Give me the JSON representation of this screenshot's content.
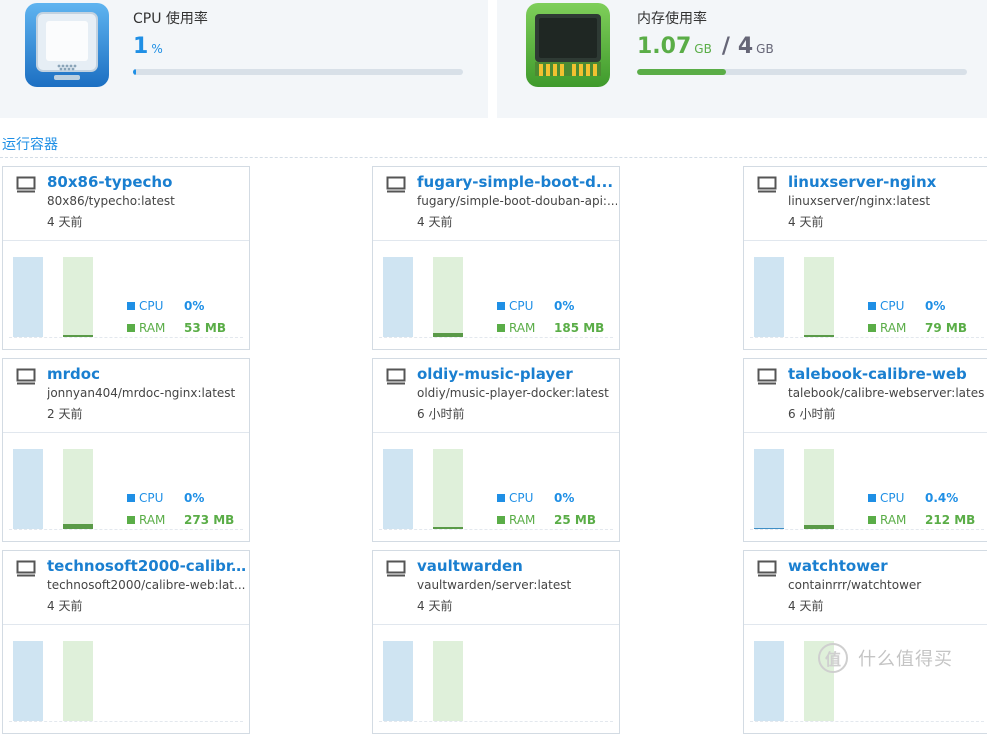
{
  "cpu_widget": {
    "title": "CPU 使用率",
    "value": "1",
    "unit": "%",
    "usage_fraction": 0.01,
    "icon": "cpu-chip-icon"
  },
  "memory_widget": {
    "title": "内存使用率",
    "used": "1.07",
    "used_unit": "GB",
    "separator": "/",
    "total": "4",
    "total_unit": "GB",
    "usage_fraction": 0.27,
    "icon": "memory-module-icon"
  },
  "section": {
    "title": "运行容器"
  },
  "legend": {
    "cpu_label": "CPU",
    "ram_label": "RAM"
  },
  "colors": {
    "cpu": "#1f8fe5",
    "ram": "#5aad47",
    "name_link": "#1a7fd0"
  },
  "containers": [
    {
      "name": "80x86-typecho",
      "image": "80x86/typecho:latest",
      "started": "4 天前",
      "cpu": "0%",
      "ram": "53 MB",
      "cpu_level": 0.0,
      "ram_level": 0.015
    },
    {
      "name": "fugary-simple-boot-d...",
      "image": "fugary/simple-boot-douban-api:...",
      "started": "4 天前",
      "cpu": "0%",
      "ram": "185 MB",
      "cpu_level": 0.0,
      "ram_level": 0.05
    },
    {
      "name": "linuxserver-nginx",
      "image": "linuxserver/nginx:latest",
      "started": "4 天前",
      "cpu": "0%",
      "ram": "79 MB",
      "cpu_level": 0.0,
      "ram_level": 0.02
    },
    {
      "name": "mrdoc",
      "image": "jonnyan404/mrdoc-nginx:latest",
      "started": "2 天前",
      "cpu": "0%",
      "ram": "273 MB",
      "cpu_level": 0.0,
      "ram_level": 0.06
    },
    {
      "name": "oldiy-music-player",
      "image": "oldiy/music-player-docker:latest",
      "started": "6 小时前",
      "cpu": "0%",
      "ram": "25 MB",
      "cpu_level": 0.0,
      "ram_level": 0.01
    },
    {
      "name": "talebook-calibre-web",
      "image": "talebook/calibre-webserver:lates",
      "started": "6 小时前",
      "cpu": "0.4%",
      "ram": "212 MB",
      "cpu_level": 0.01,
      "ram_level": 0.05
    },
    {
      "name": "technosoft2000-calibr...",
      "image": "technosoft2000/calibre-web:lat...",
      "started": "4 天前",
      "cpu": "",
      "ram": "",
      "cpu_level": 0.0,
      "ram_level": 0.0
    },
    {
      "name": "vaultwarden",
      "image": "vaultwarden/server:latest",
      "started": "4 天前",
      "cpu": "",
      "ram": "",
      "cpu_level": 0.0,
      "ram_level": 0.0
    },
    {
      "name": "watchtower",
      "image": "containrrr/watchtower",
      "started": "4 天前",
      "cpu": "",
      "ram": "",
      "cpu_level": 0.0,
      "ram_level": 0.0
    }
  ],
  "watermark": {
    "logo_text": "值",
    "text": "什么值得买"
  }
}
